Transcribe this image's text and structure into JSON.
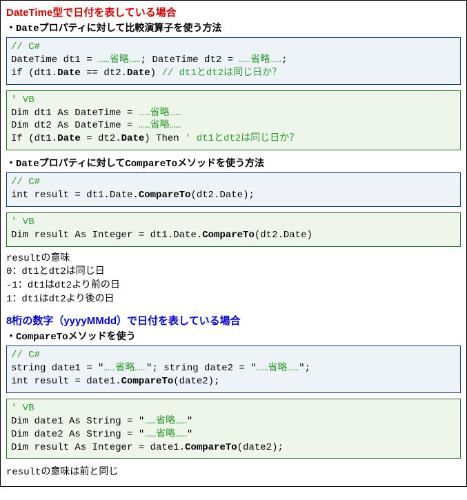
{
  "section1": {
    "title": "DateTime型で日付を表している場合",
    "sub1_pre": "・",
    "sub1_mono": "Date",
    "sub1_post": "プロパティに対して比較演算子を使う方法",
    "cs1": {
      "comment": "// C#",
      "l1a": "DateTime dt1 = ",
      "l1b": "……省略……",
      "l1c": "; DateTime dt2 = ",
      "l1d": "……省略……",
      "l1e": ";",
      "l2a": "if (dt1.",
      "l2b": "Date",
      "l2c": " == dt2.",
      "l2d": "Date",
      "l2e": ") ",
      "l2f": "// dt1とdt2は同じ日か？"
    },
    "vb1": {
      "comment": "' VB",
      "l1a": "Dim dt1 As DateTime = ",
      "l1b": "……省略……",
      "l2a": "Dim dt2 As DateTime = ",
      "l2b": "……省略……",
      "l3a": "If (dt1.",
      "l3b": "Date",
      "l3c": " = dt2.",
      "l3d": "Date",
      "l3e": ") Then ",
      "l3f": "' dt1とdt2は同じ日か？"
    },
    "sub2_pre": "・",
    "sub2_mono1": "Date",
    "sub2_mid": "プロパティに対して",
    "sub2_mono2": "CompareTo",
    "sub2_post": "メソッドを使う方法",
    "cs2": {
      "comment": "// C#",
      "l1a": "int result = dt1.Date.",
      "l1b": "CompareTo",
      "l1c": "(dt2.Date);"
    },
    "vb2": {
      "comment": "' VB",
      "l1a": "Dim result As Integer = dt1.Date.",
      "l1b": "CompareTo",
      "l1c": "(dt2.Date)"
    },
    "result_text": "resultの意味\n0：dt1とdt2は同じ日\n-1：dt1はdt2より前の日\n1：dt1はdt2より後の日"
  },
  "section2": {
    "title": "8桁の数字（yyyyMMdd）で日付を表している場合",
    "sub_pre": "・",
    "sub_mono": "CompareTo",
    "sub_post": "メソッドを使う",
    "cs": {
      "comment": "// C#",
      "l1a": "string date1 = \"",
      "l1b": "……省略……",
      "l1c": "\"; string date2 = \"",
      "l1d": "……省略……",
      "l1e": "\";",
      "l2a": "int result = date1.",
      "l2b": "CompareTo",
      "l2c": "(date2);"
    },
    "vb": {
      "comment": "' VB",
      "l1a": "Dim date1 As String = \"",
      "l1b": "……省略……",
      "l1c": "\"",
      "l2a": "Dim date2 As String = \"",
      "l2b": "……省略……",
      "l2c": "\"",
      "l3a": "Dim result As Integer = date1.",
      "l3b": "CompareTo",
      "l3c": "(date2);"
    },
    "result_pre": "result",
    "result_post": "の意味は前と同じ"
  }
}
